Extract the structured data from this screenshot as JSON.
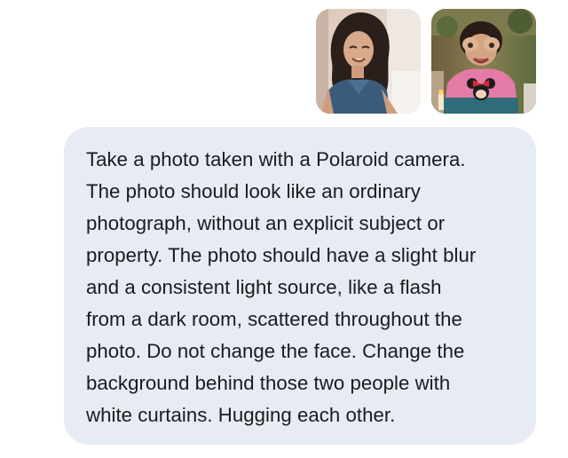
{
  "conversation": {
    "attachments": [
      {
        "icon": "photo-girl-smiling"
      },
      {
        "icon": "photo-child-pink-sweater"
      }
    ],
    "message": {
      "text": "Take a photo taken with a Polaroid camera.\nThe photo should look like an ordinary\nphotograph, without an explicit subject or\nproperty. The photo should have a slight blur\nand a consistent light source, like a flash\nfrom a dark room, scattered throughout the\nphoto. Do not change the face. Change the\nbackground behind those two people with\nwhite curtains. Hugging each other."
    }
  },
  "colors": {
    "bubble_background": "#e7ebf3",
    "text": "#1b1b1d"
  }
}
